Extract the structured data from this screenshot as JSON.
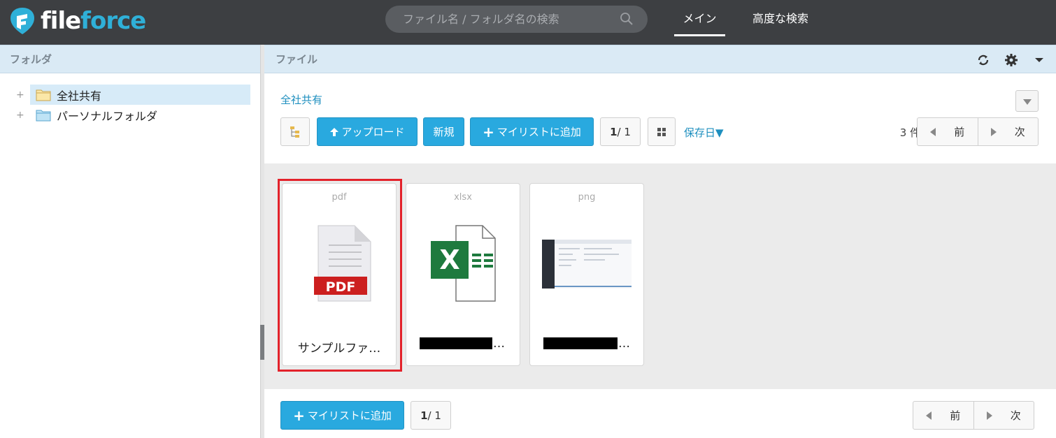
{
  "header": {
    "logo_text_accent": "fi",
    "logo_text_main": "le",
    "logo_text_accent2": "force",
    "search_placeholder": "ファイル名 / フォルダ名の検索",
    "tabs": [
      {
        "label": "メイン",
        "active": true
      },
      {
        "label": "高度な検索",
        "active": false
      }
    ],
    "bg_color": "#3d3f42",
    "accent_color": "#2fb0d8"
  },
  "folder_panel": {
    "title": "フォルダ",
    "tree": [
      {
        "label": "全社共有",
        "selected": true,
        "expander": "+"
      },
      {
        "label": "パーソナルフォルダ",
        "selected": false,
        "expander": "+"
      }
    ]
  },
  "file_panel": {
    "title": "ファイル",
    "breadcrumb": "全社共有",
    "toolbar": {
      "upload_label": "アップロード",
      "new_label": "新規",
      "add_mylist_label": "マイリストに追加",
      "page_current": "1",
      "page_total": " / 1",
      "sort_label": "保存日▼",
      "count_label": "3 件",
      "prev_label": "前",
      "next_label": "次"
    },
    "files": [
      {
        "ext": "pdf",
        "name": "サンプルファ…",
        "icon": "pdf-file-icon",
        "selected": true
      },
      {
        "ext": "xlsx",
        "name": "…",
        "icon": "excel-file-icon",
        "selected": false,
        "redacted": true
      },
      {
        "ext": "png",
        "name": "…",
        "icon": "image-thumbnail",
        "selected": false,
        "redacted": true
      }
    ],
    "bottom": {
      "add_mylist_label": "マイリストに追加",
      "page_current": "1",
      "page_total": " / 1",
      "prev_label": "前",
      "next_label": "次"
    }
  },
  "colors": {
    "primary_button": "#29a9df",
    "panel_header": "#daeaf5",
    "highlight": "#e3222b",
    "link": "#1e8fbf"
  }
}
